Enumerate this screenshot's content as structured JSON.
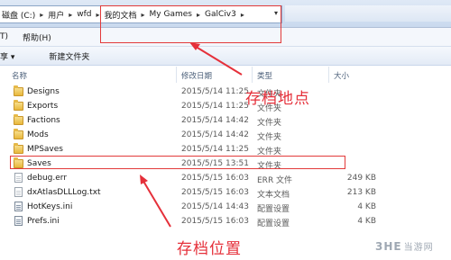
{
  "address_bar": {
    "crumbs": [
      "磁盘 (C:)",
      "用户",
      "wfd",
      "我的文档",
      "My Games",
      "GalCiv3"
    ]
  },
  "menu": [
    "T)",
    "帮助(H)"
  ],
  "toolbar": {
    "share": "享 ▾",
    "new_folder": "新建文件夹"
  },
  "columns": {
    "name": "名称",
    "date": "修改日期",
    "type": "类型",
    "size": "大小"
  },
  "rows": [
    {
      "name": "Designs",
      "date": "2015/5/14 11:25",
      "type": "文件夹",
      "size": "",
      "icon": "folder-icon"
    },
    {
      "name": "Exports",
      "date": "2015/5/14 11:25",
      "type": "文件夹",
      "size": "",
      "icon": "folder-icon"
    },
    {
      "name": "Factions",
      "date": "2015/5/14 14:42",
      "type": "文件夹",
      "size": "",
      "icon": "folder-icon"
    },
    {
      "name": "Mods",
      "date": "2015/5/14 14:42",
      "type": "文件夹",
      "size": "",
      "icon": "folder-icon"
    },
    {
      "name": "MPSaves",
      "date": "2015/5/14 11:25",
      "type": "文件夹",
      "size": "",
      "icon": "folder-icon"
    },
    {
      "name": "Saves",
      "date": "2015/5/15 13:51",
      "type": "文件夹",
      "size": "",
      "icon": "folder-icon"
    },
    {
      "name": "debug.err",
      "date": "2015/5/15 16:03",
      "type": "ERR 文件",
      "size": "249 KB",
      "icon": "file-icon"
    },
    {
      "name": "dxAtlasDLLLog.txt",
      "date": "2015/5/15 16:03",
      "type": "文本文档",
      "size": "213 KB",
      "icon": "file-icon"
    },
    {
      "name": "HotKeys.ini",
      "date": "2015/5/14 14:43",
      "type": "配置设置",
      "size": "4 KB",
      "icon": "config-file-icon"
    },
    {
      "name": "Prefs.ini",
      "date": "2015/5/15 16:03",
      "type": "配置设置",
      "size": "4 KB",
      "icon": "config-file-icon"
    }
  ],
  "annotations": {
    "location_label": "存档地点",
    "position_label": "存档位置",
    "color": "#e5303a"
  },
  "watermark": {
    "logo": "3HE",
    "text": "当游网"
  }
}
